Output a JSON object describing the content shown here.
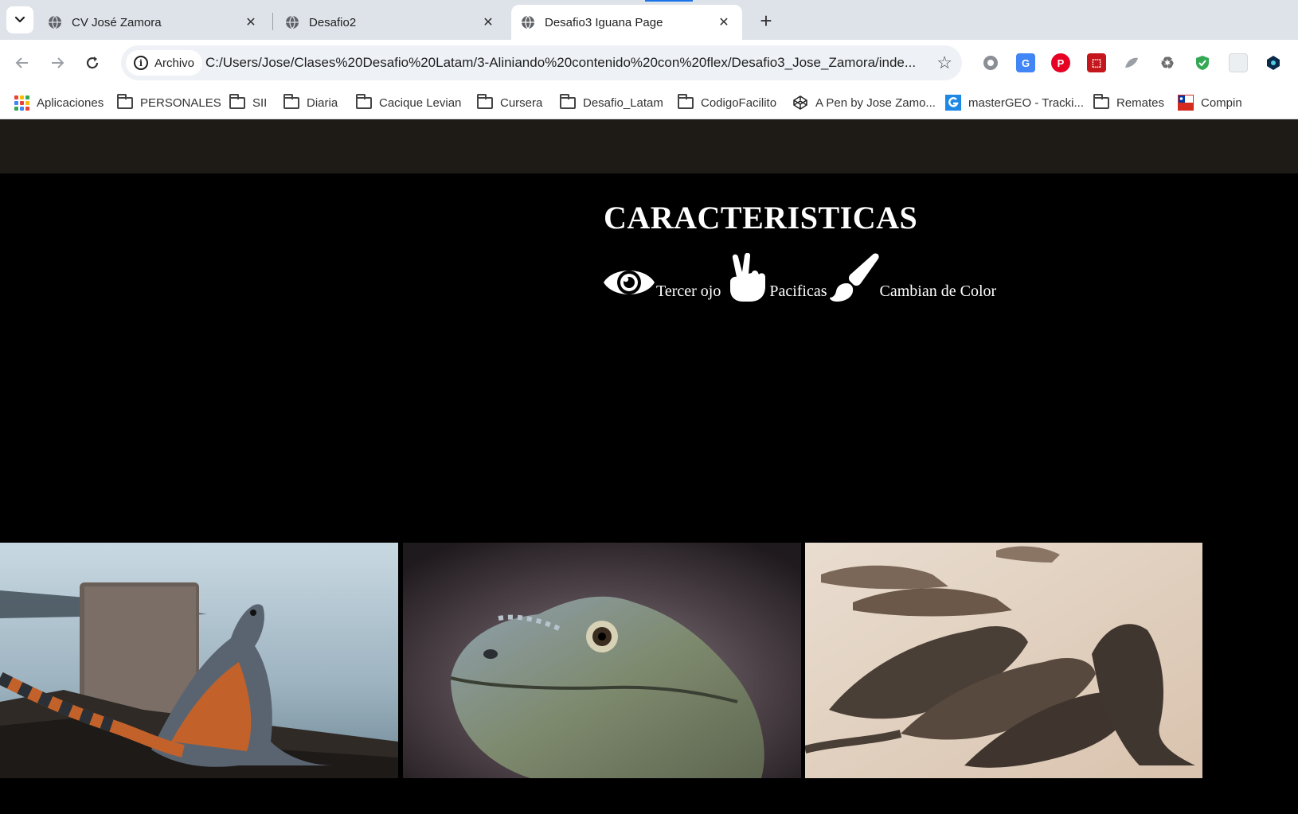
{
  "browser": {
    "tabs": [
      {
        "title": "CV José Zamora",
        "active": false
      },
      {
        "title": "Desafio2",
        "active": false
      },
      {
        "title": "Desafio3 Iguana Page",
        "active": true
      }
    ],
    "site_chip_label": "Archivo",
    "url": "C:/Users/Jose/Clases%20Desafio%20Latam/3-Aliniando%20contenido%20con%20flex/Desafio3_Jose_Zamora/inde...",
    "bookmarks": [
      {
        "label": "Aplicaciones",
        "icon": "apps-grid-icon"
      },
      {
        "label": "PERSONALES",
        "icon": "folder-icon"
      },
      {
        "label": "SII",
        "icon": "folder-icon"
      },
      {
        "label": "Diaria",
        "icon": "folder-icon"
      },
      {
        "label": "Cacique Levian",
        "icon": "folder-icon"
      },
      {
        "label": "Cursera",
        "icon": "folder-icon"
      },
      {
        "label": "Desafio_Latam",
        "icon": "folder-icon"
      },
      {
        "label": "CodigoFacilito",
        "icon": "folder-icon"
      },
      {
        "label": "A Pen by Jose Zamo...",
        "icon": "codepen-icon"
      },
      {
        "label": "masterGEO - Tracki...",
        "icon": "mastergeo-icon"
      },
      {
        "label": "Remates",
        "icon": "folder-icon"
      },
      {
        "label": "Compin",
        "icon": "chile-flag-icon"
      }
    ],
    "extensions": [
      "settings-extension-icon",
      "google-translate-icon",
      "pinterest-icon",
      "pdf-icon",
      "leaf-extension-icon",
      "recycle-extension-icon",
      "shield-extension-icon",
      "blank-extension-icon",
      "puzzle-extension-icon"
    ]
  },
  "page": {
    "heading": "CARACTERISTICAS",
    "features": [
      {
        "label": "Tercer ojo",
        "icon": "eye-icon"
      },
      {
        "label": "Pacificas",
        "icon": "peace-hand-icon"
      },
      {
        "label": "Cambian de Color",
        "icon": "paintbrush-icon"
      }
    ],
    "photos": [
      {
        "subject": "iguana-on-rocks-by-water"
      },
      {
        "subject": "iguana-head-closeup"
      },
      {
        "subject": "iguanas-on-sand"
      }
    ]
  },
  "colors": {
    "tabstrip_bg": "#dee3ea",
    "page_bg": "#000000",
    "page_nav_bg": "#1e1b16",
    "heading_color": "#ffffff",
    "accent": "#1a73e8"
  }
}
